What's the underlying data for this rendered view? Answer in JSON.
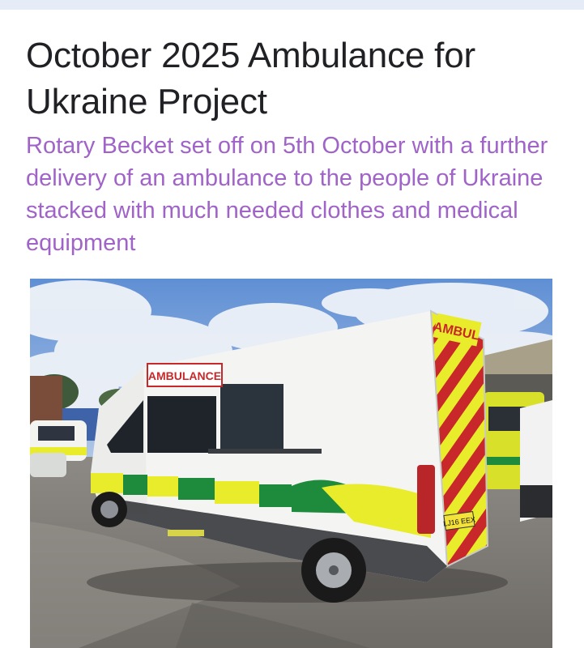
{
  "article": {
    "title": "October 2025 Ambulance for Ukraine Project",
    "subtitle": "Rotary Becket set off on 5th October with a further delivery of an ambulance to the people of Ukraine stacked with much needed clothes and medical equipment"
  },
  "photo": {
    "side_label": "AMBULANCE",
    "rear_label": "AMBUL",
    "plate": "LJ16 EEX"
  },
  "colors": {
    "title": "#202124",
    "subtitle_accent": "#a064c8",
    "ambulance_yellow": "#e8ec2a",
    "ambulance_green": "#1e8a3c",
    "chevron_red": "#c8282a",
    "sky": "#7aa6de"
  }
}
